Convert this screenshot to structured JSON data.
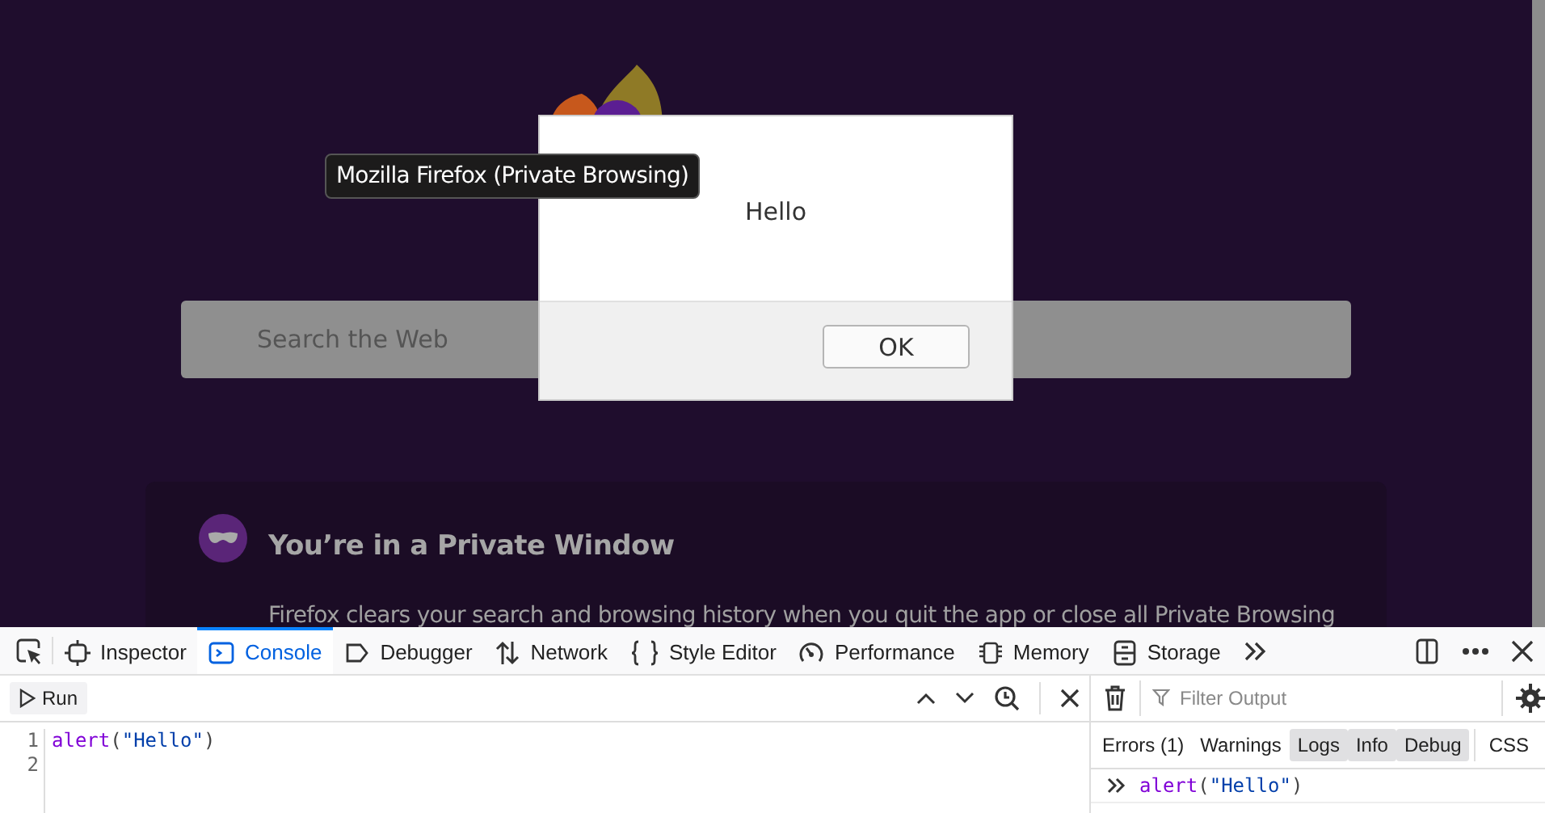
{
  "page": {
    "search": {
      "placeholder": "Search the Web"
    },
    "private_card": {
      "title": "You’re in a Private Window",
      "body": "Firefox clears your search and browsing history when you quit the app or close all Private Browsing"
    }
  },
  "tooltip": {
    "text": "Mozilla Firefox (Private Browsing)"
  },
  "dialog": {
    "message": "Hello",
    "buttons": [
      "OK"
    ]
  },
  "devtools": {
    "tabs": [
      {
        "label": "Inspector",
        "selected": false
      },
      {
        "label": "Console",
        "selected": true
      },
      {
        "label": "Debugger",
        "selected": false
      },
      {
        "label": "Network",
        "selected": false
      },
      {
        "label": "Style Editor",
        "selected": false
      },
      {
        "label": "Performance",
        "selected": false
      },
      {
        "label": "Memory",
        "selected": false
      },
      {
        "label": "Storage",
        "selected": false
      }
    ],
    "editor": {
      "run_label": "Run",
      "lines": [
        {
          "number": "1",
          "text": "alert(\"Hello\")"
        },
        {
          "number": "2"
        }
      ]
    },
    "console": {
      "filter": {
        "placeholder": "Filter Output"
      },
      "filters": [
        {
          "label": "Errors (1)",
          "selected": false
        },
        {
          "label": "Warnings",
          "selected": false
        },
        {
          "label": "Logs",
          "selected": true
        },
        {
          "label": "Info",
          "selected": true
        },
        {
          "label": "Debug",
          "selected": true
        },
        {
          "label": "CSS",
          "selected": false
        }
      ],
      "output": [
        {
          "text": "alert(\"Hello\")"
        }
      ]
    }
  }
}
